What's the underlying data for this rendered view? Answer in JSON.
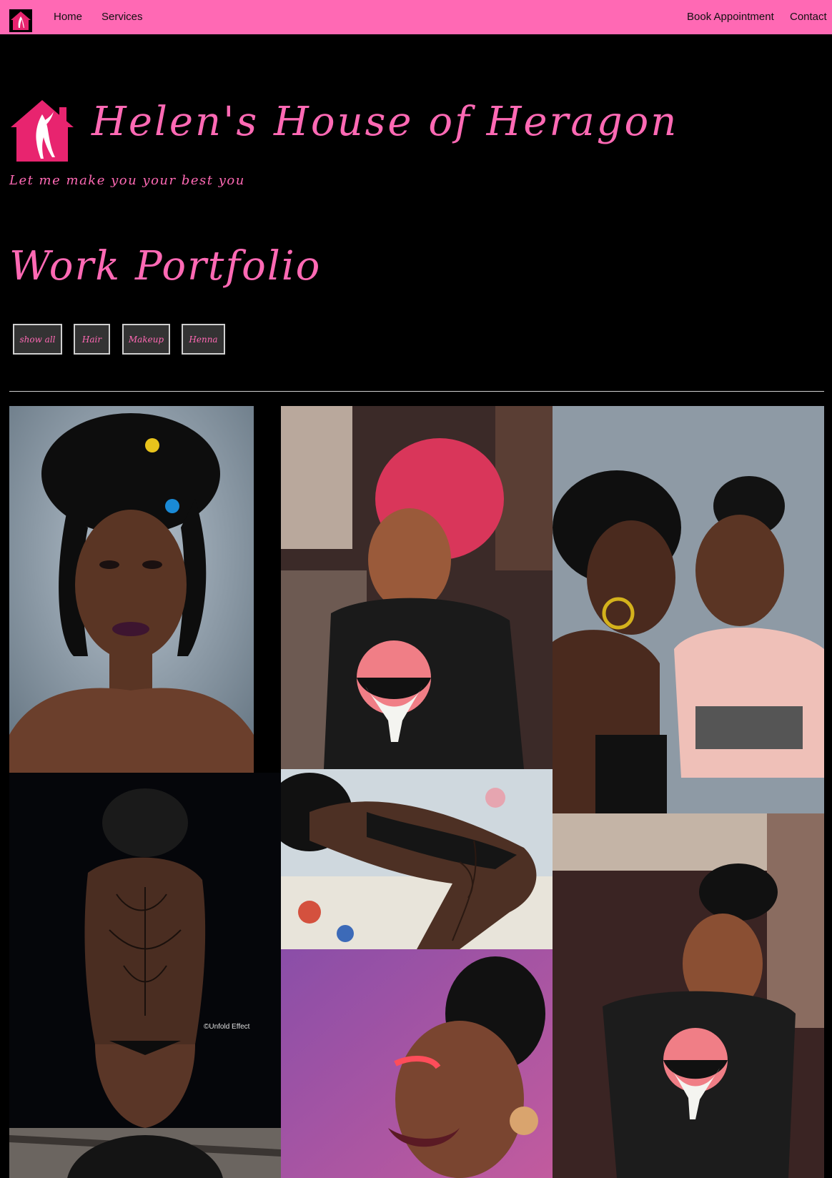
{
  "nav": {
    "home": "Home",
    "services": "Services",
    "book": "Book Appointment",
    "contact": "Contact"
  },
  "hero": {
    "title": "Helen's House of Heragon",
    "tagline": "Let me make you your best you"
  },
  "portfolio": {
    "title": "Work Portfolio",
    "filters": [
      "show all",
      "Hair",
      "Makeup",
      "Henna"
    ]
  },
  "gallery": {
    "watermark": "©Unfold Effect"
  },
  "colors": {
    "accent": "#ff69b4",
    "logo_pink": "#e8246f",
    "background": "#000000"
  }
}
